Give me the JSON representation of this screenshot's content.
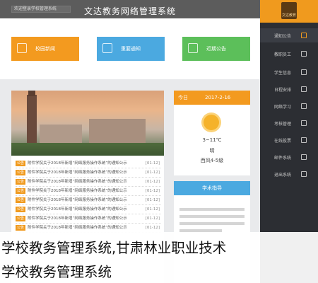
{
  "header": {
    "welcome": "欢迎登录学校管理系统",
    "title": "文达教务网络管理系统"
  },
  "sidebar": {
    "logo": "文达教育",
    "items": [
      {
        "label": "通知公告",
        "icon": "bell-icon",
        "active": true
      },
      {
        "label": "教职员工",
        "icon": "person-icon",
        "active": false
      },
      {
        "label": "学生信息",
        "icon": "graduation-cap-icon",
        "active": false
      },
      {
        "label": "日程安排",
        "icon": "calendar-icon",
        "active": false
      },
      {
        "label": "网络学习",
        "icon": "book-icon",
        "active": false
      },
      {
        "label": "考核管理",
        "icon": "clipboard-icon",
        "active": false
      },
      {
        "label": "在线投票",
        "icon": "vote-icon",
        "active": false
      },
      {
        "label": "邮件系统",
        "icon": "mail-icon",
        "active": false
      },
      {
        "label": "退出系统",
        "icon": "logout-icon",
        "active": false
      }
    ]
  },
  "tiles": [
    {
      "label": "校园新闻",
      "color": "#f39a1f",
      "icon": "news-icon"
    },
    {
      "label": "重要通知",
      "color": "#4ba9e0",
      "icon": "notice-icon"
    },
    {
      "label": "近期公告",
      "color": "#5cbf5a",
      "icon": "announcement-icon"
    }
  ],
  "news": {
    "rows": [
      {
        "tag": "公告",
        "text": "附件学院关于2018年新增“网络服务操作系统”的通知公示",
        "date": "[01-12]"
      },
      {
        "tag": "公告",
        "text": "附件学院关于2018年新增“网络服务操作系统”的通知公示",
        "date": "[01-12]"
      },
      {
        "tag": "公告",
        "text": "附件学院关于2018年新增“网络服务操作系统”的通知公示",
        "date": "[01-12]"
      },
      {
        "tag": "公告",
        "text": "附件学院关于2018年新增“网络服务操作系统”的通知公示",
        "date": "[01-12]"
      },
      {
        "tag": "公告",
        "text": "附件学院关于2018年新增“网络服务操作系统”的通知公示",
        "date": "[01-12]"
      },
      {
        "tag": "公告",
        "text": "附件学院关于2018年新增“网络服务操作系统”的通知公示",
        "date": "[01-12]"
      },
      {
        "tag": "公告",
        "text": "附件学院关于2018年新增“网络服务操作系统”的通知公示",
        "date": "[01-12]"
      },
      {
        "tag": "公告",
        "text": "附件学院关于2018年新增“网络服务操作系统”的通知公示",
        "date": "[01-12]"
      }
    ]
  },
  "weather": {
    "today": "今日",
    "date": "2017-2-16",
    "temp": "3~11℃",
    "cond": "晴",
    "wind": "西风4-5级"
  },
  "board": {
    "title": "学术指导"
  },
  "caption": {
    "line1": "学校教务管理系统,甘肃林业职业技术",
    "line2": "学校教务管理系统"
  }
}
